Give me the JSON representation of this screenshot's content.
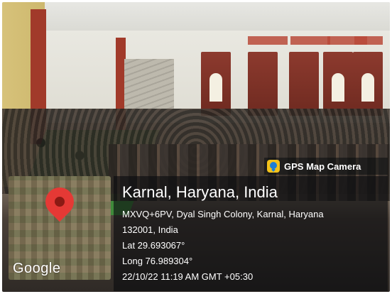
{
  "photo": {
    "subject": ""
  },
  "gps_badge": {
    "app_name": "GPS Map Camera",
    "logo_icon": "gps-map-camera-logo-icon"
  },
  "map": {
    "provider_logo": "Google"
  },
  "location": {
    "city_line": "Karnal, Haryana, India",
    "address_line1": "MXVQ+6PV, Dyal Singh Colony, Karnal, Haryana",
    "address_line2": "132001, India",
    "lat": "Lat 29.693067°",
    "long": "Long 76.989304°",
    "timestamp": "22/10/22 11:19 AM GMT +05:30"
  }
}
